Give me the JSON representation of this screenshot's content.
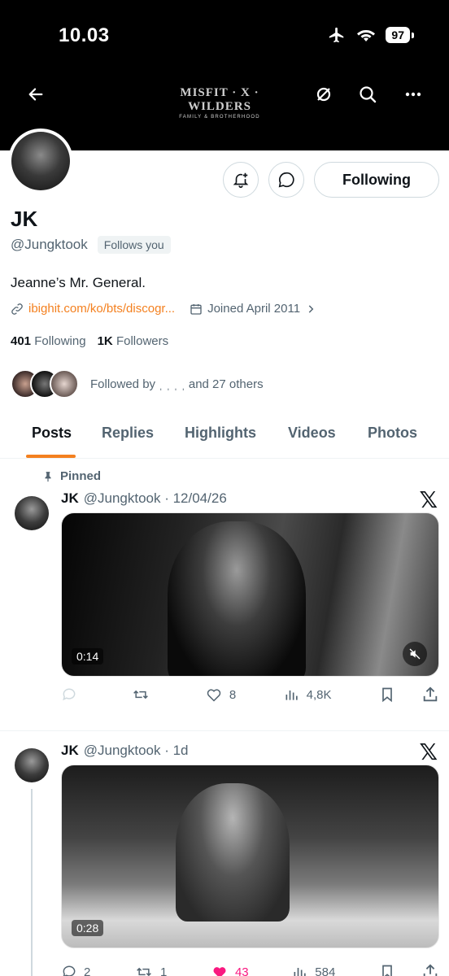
{
  "status_bar": {
    "time": "10.03",
    "battery": "97"
  },
  "header": {
    "brand_main": "MISFIT · X · WILDERS",
    "brand_sub": "FAMILY & BROTHERHOOD"
  },
  "profile": {
    "name": "JK",
    "handle": "@Jungktook",
    "follows_you": "Follows you",
    "bio": "Jeanne’s Mr. General.",
    "link": "ibighit.com/ko/bts/discogr...",
    "joined": "Joined April 2011",
    "following_count": "401",
    "following_label": "Following",
    "followers_count": "1K",
    "followers_label": "Followers",
    "followed_by": "Followed by ˌ ˌ ˌ ˌ and 27 others",
    "following_button": "Following"
  },
  "tabs": [
    "Posts",
    "Replies",
    "Highlights",
    "Videos",
    "Photos"
  ],
  "tweets": [
    {
      "pinned_label": "Pinned",
      "name": "JK",
      "meta": "@Jungktook · 12/04/26",
      "duration": "0:14",
      "replies": "",
      "retweets": "",
      "likes": "8",
      "views": "4,8K"
    },
    {
      "name": "JK",
      "meta": "@Jungktook · 1d",
      "duration": "0:28",
      "replies": "2",
      "retweets": "1",
      "likes": "43",
      "views": "584"
    }
  ],
  "colors": {
    "accent": "#f4801f",
    "like": "#f91880",
    "muted": "#536471"
  }
}
